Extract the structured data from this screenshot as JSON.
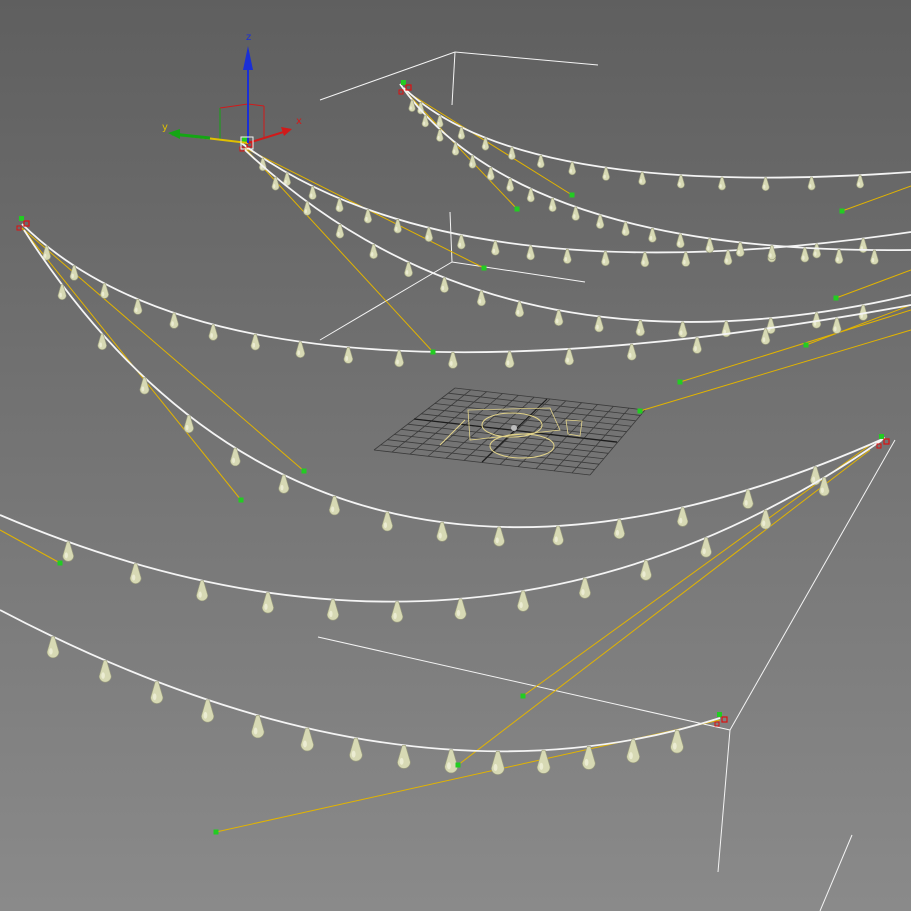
{
  "viewport": {
    "background_top": "#5f5f5f",
    "background_bottom": "#8a8a8a",
    "wire_color": "#f4f4f4",
    "target_line_color": "#e2b400",
    "handle_color": "#22cc22",
    "selected_handle_color": "#dd1111",
    "bulb_color": "#d7d9b4",
    "bulb_shade": "#9b9d7e",
    "grid_color": "#3a3a3a",
    "logo_color": "#e3d48a"
  },
  "gizmo": {
    "x_label": "x",
    "y_label": "y",
    "z_label": "z",
    "x_color": "#d11a1a",
    "y_color": "#14a514",
    "z_color": "#1a2fd6"
  },
  "garlands": [
    {
      "id": "a",
      "bulbs": 14
    },
    {
      "id": "b",
      "bulbs": 18
    },
    {
      "id": "c",
      "bulbs": 20
    },
    {
      "id": "d",
      "bulbs": 16
    },
    {
      "id": "e",
      "bulbs": 17
    },
    {
      "id": "f",
      "bulbs": 15
    },
    {
      "id": "g",
      "bulbs": 13
    },
    {
      "id": "h",
      "bulbs": 14
    }
  ]
}
